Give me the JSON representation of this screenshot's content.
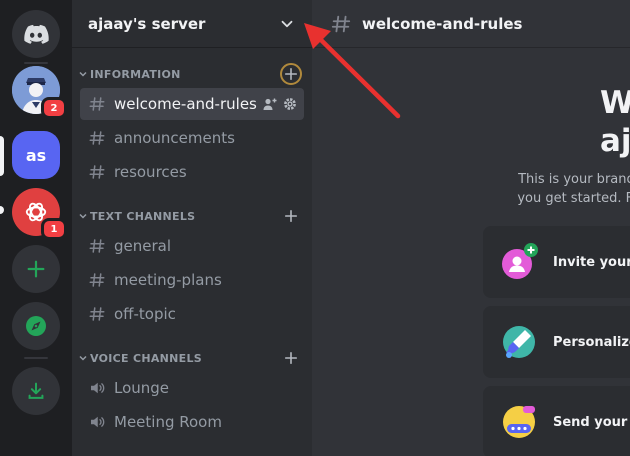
{
  "server": {
    "name": "ajaay's server"
  },
  "rail": {
    "items": [
      {
        "icon": "discord-home-icon"
      },
      {
        "icon": "avatar-icon",
        "badge": "2"
      },
      {
        "label": "as"
      },
      {
        "icon": "openai-icon",
        "badge": "1"
      },
      {
        "icon": "add-server-icon"
      },
      {
        "icon": "explore-compass-icon"
      },
      {
        "icon": "download-icon"
      }
    ]
  },
  "sidebar": {
    "categories": [
      {
        "label": "INFORMATION",
        "channels": [
          {
            "label": "welcome-and-rules",
            "type": "text",
            "active": true
          },
          {
            "label": "announcements",
            "type": "text"
          },
          {
            "label": "resources",
            "type": "text"
          }
        ]
      },
      {
        "label": "TEXT CHANNELS",
        "channels": [
          {
            "label": "general",
            "type": "text"
          },
          {
            "label": "meeting-plans",
            "type": "text"
          },
          {
            "label": "off-topic",
            "type": "text"
          }
        ]
      },
      {
        "label": "VOICE CHANNELS",
        "channels": [
          {
            "label": "Lounge",
            "type": "voice"
          },
          {
            "label": "Meeting Room",
            "type": "voice"
          }
        ]
      }
    ]
  },
  "main": {
    "channel_title": "welcome-and-rules",
    "welcome_line1": "We",
    "welcome_line2": "aja",
    "intro_line1": "This is your brand new,",
    "intro_line2": "you get started. For mo",
    "cards": [
      {
        "label": "Invite your fr",
        "icon": "invite-friends-icon"
      },
      {
        "label": "Personalize y",
        "icon": "personalize-brush-icon"
      },
      {
        "label": "Send your fir",
        "icon": "send-message-icon"
      }
    ]
  },
  "colors": {
    "accent": "#5865f2",
    "annotation_arrow": "#e8312f",
    "badge": "#f23f43",
    "green": "#23a559"
  }
}
